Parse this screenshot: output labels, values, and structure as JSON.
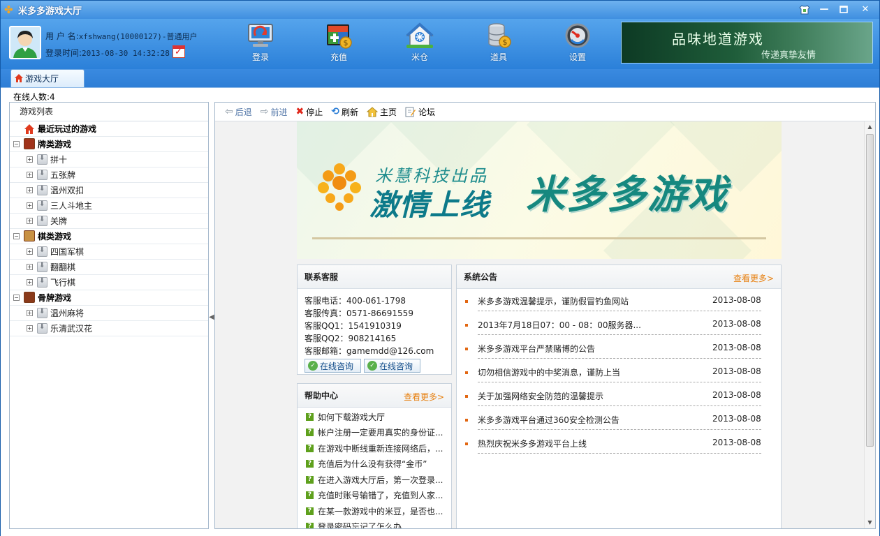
{
  "window": {
    "title": "米多多游戏大厅"
  },
  "user": {
    "name_label": "用 户 名:",
    "name_value": "xfshwang(10000127)-普通用户",
    "login_label": "登录时间:",
    "login_value": "2013-08-30 14:32:28"
  },
  "nav": [
    {
      "label": "登录"
    },
    {
      "label": "充值"
    },
    {
      "label": "米仓"
    },
    {
      "label": "道具"
    },
    {
      "label": "设置"
    }
  ],
  "banner_top": {
    "line1": "品味地道游戏",
    "line2": "传递真挚友情"
  },
  "tab": {
    "label": "游戏大厅"
  },
  "online": "在线人数:4",
  "game_list": {
    "header": "游戏列表",
    "recent": "最近玩过的游戏",
    "categories": [
      {
        "label": "牌类游戏",
        "games": [
          "拼十",
          "五张牌",
          "温州双扣",
          "三人斗地主",
          "关牌"
        ]
      },
      {
        "label": "棋类游戏",
        "games": [
          "四国军棋",
          "翻翻棋",
          "飞行棋"
        ]
      },
      {
        "label": "骨牌游戏",
        "games": [
          "温州麻将",
          "乐清武汉花"
        ]
      }
    ]
  },
  "toolbar": {
    "back": "后退",
    "forward": "前进",
    "stop": "停止",
    "refresh": "刷新",
    "home": "主页",
    "forum": "论坛"
  },
  "hero": {
    "sub": "米慧科技出品",
    "main1": "激情上线",
    "main2": "米多多游戏"
  },
  "customer_service": {
    "title": "联系客服",
    "lines": [
      "客服电话：400-061-1798",
      "客服传真：0571-86691559",
      "客服QQ1：1541910319",
      "客服QQ2：908214165",
      "客服邮箱：gamemdd@126.com"
    ],
    "buttons": [
      "在线咨询",
      "在线咨询"
    ]
  },
  "help": {
    "title": "帮助中心",
    "more": "查看更多>",
    "items": [
      "如何下载游戏大厅",
      "帐户注册一定要用真实的身份证...",
      "在游戏中断线重新连接网络后，...",
      "充值后为什么没有获得“金币”",
      "在进入游戏大厅后，第一次登录...",
      "充值时账号输错了，充值到人家...",
      "在某一款游戏中的米豆，是否也...",
      "登录密码忘记了怎么办"
    ]
  },
  "announcements": {
    "title": "系统公告",
    "more": "查看更多>",
    "items": [
      {
        "text": "米多多游戏温馨提示，谨防假冒钓鱼网站",
        "date": "2013-08-08"
      },
      {
        "text": "2013年7月18日07：00 - 08：00服务器...",
        "date": "2013-08-08"
      },
      {
        "text": "米多多游戏平台严禁赌博的公告",
        "date": "2013-08-08"
      },
      {
        "text": "切勿相信游戏中的中奖消息，谨防上当",
        "date": "2013-08-08"
      },
      {
        "text": "关于加强网络安全防范的温馨提示",
        "date": "2013-08-08"
      },
      {
        "text": "米多多游戏平台通过360安全检测公告",
        "date": "2013-08-08"
      },
      {
        "text": "热烈庆祝米多多游戏平台上线",
        "date": "2013-08-08"
      }
    ]
  }
}
